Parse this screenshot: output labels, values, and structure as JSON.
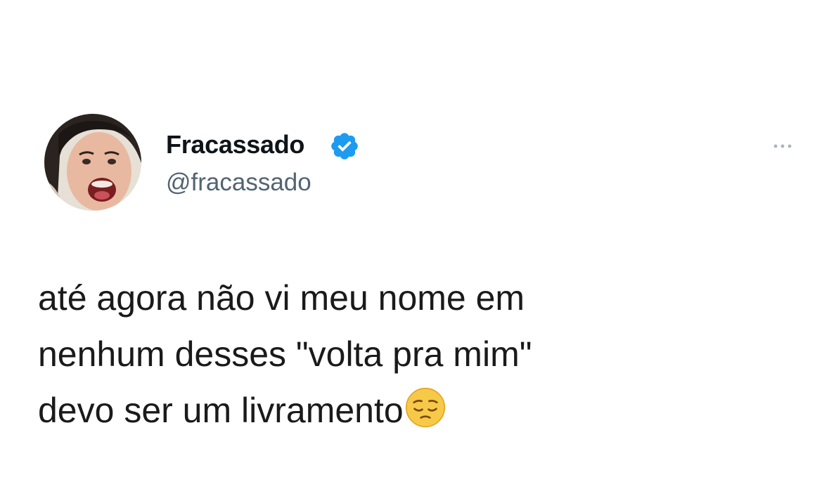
{
  "author": {
    "display_name": "Fracassado",
    "handle": "@fracassado",
    "verified_color": "#1d9bf0"
  },
  "tweet": {
    "lines": [
      "até agora não vi meu nome em",
      "nenhum desses \"volta pra mim\"",
      "devo ser um livramento"
    ],
    "emoji": "pensive-face"
  },
  "icons": {
    "more": "more-horizontal-icon",
    "verified": "verified-badge-icon"
  },
  "colors": {
    "text": "#0f1419",
    "secondary": "#536471",
    "background": "#ffffff"
  }
}
